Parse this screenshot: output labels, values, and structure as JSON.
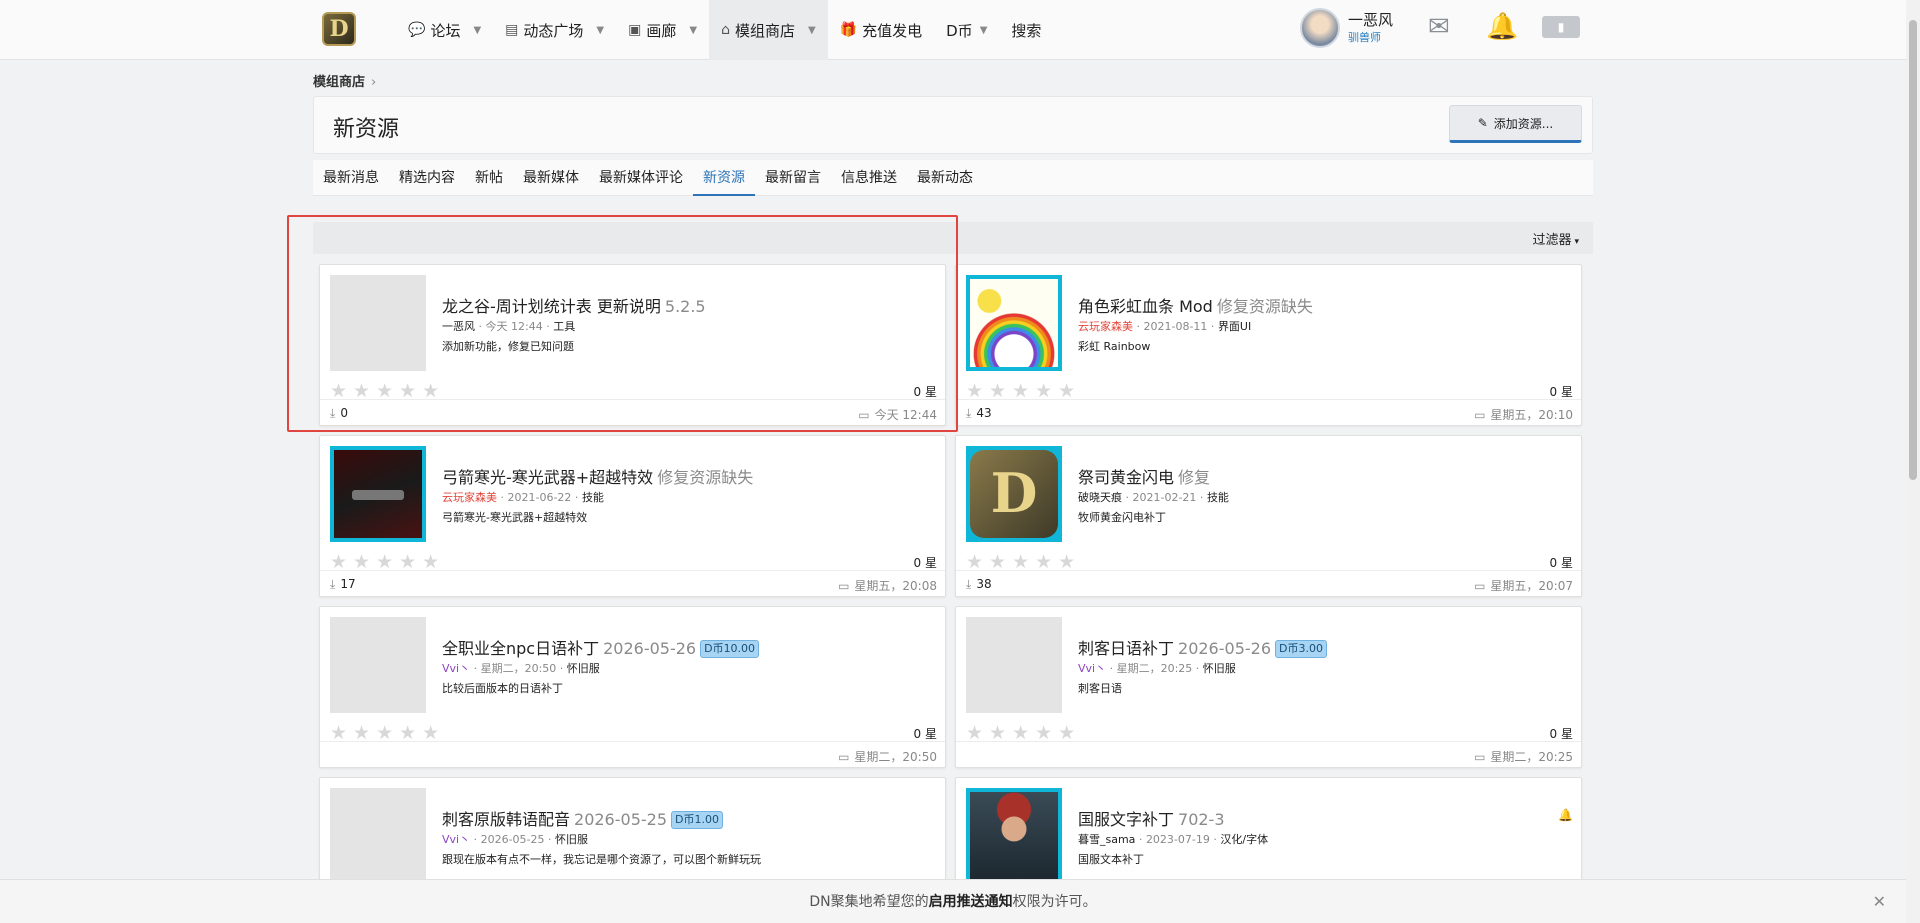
{
  "header": {
    "logo": "D",
    "nav": [
      {
        "label": "论坛",
        "icon": "chat-icon",
        "dropdown": true
      },
      {
        "label": "动态广场",
        "icon": "feed-icon",
        "dropdown": true
      },
      {
        "label": "画廊",
        "icon": "image-icon",
        "dropdown": true
      },
      {
        "label": "模组商店",
        "icon": "store-icon",
        "dropdown": true,
        "active": true
      },
      {
        "label": "充值发电",
        "icon": "gift-icon",
        "dropdown": false
      },
      {
        "label": "D币",
        "icon": "",
        "dropdown": true
      },
      {
        "label": "搜索",
        "icon": "",
        "dropdown": false
      }
    ],
    "user": {
      "name": "一恶风",
      "title": "驯兽师"
    }
  },
  "breadcrumb": {
    "item": "模组商店",
    "sep": "›"
  },
  "page": {
    "title": "新资源",
    "add_button": "添加资源..."
  },
  "tabs": [
    "最新消息",
    "精选内容",
    "新帖",
    "最新媒体",
    "最新媒体评论",
    "新资源",
    "最新留言",
    "信息推送",
    "最新动态"
  ],
  "active_tab": "新资源",
  "filter": {
    "label": "过滤器",
    "caret": "▾"
  },
  "resources": [
    {
      "title": "龙之谷-周计划统计表",
      "suffix": "更新说明",
      "version": "5.2.5",
      "badge": "",
      "author": "一恶风",
      "author_color": "default",
      "date": "今天 12:44",
      "category": "工具",
      "desc": "添加新功能，修复已知问题",
      "rating": "0 星",
      "downloads": "0",
      "updated": "今天 12:44",
      "thumb": "blank"
    },
    {
      "title": "角色彩虹血条 Mod",
      "suffix": "",
      "version": "修复资源缺失",
      "badge": "",
      "author": "云玩家森美",
      "author_color": "red",
      "date": "2021-08-11",
      "category": "界面UI",
      "desc": "彩虹 Rainbow",
      "rating": "0 星",
      "downloads": "43",
      "updated": "星期五，20:10",
      "thumb": "rainbow"
    },
    {
      "title": "弓箭寒光-寒光武器+超越特效",
      "suffix": "",
      "version": "修复资源缺失",
      "badge": "",
      "author": "云玩家森美",
      "author_color": "red",
      "date": "2021-06-22",
      "category": "技能",
      "desc": "弓箭寒光-寒光武器+超越特效",
      "rating": "0 星",
      "downloads": "17",
      "updated": "星期五，20:08",
      "thumb": "dark"
    },
    {
      "title": "祭司黄金闪电",
      "suffix": "",
      "version": "修复",
      "badge": "",
      "author": "破晓天痕",
      "author_color": "default",
      "date": "2021-02-21",
      "category": "技能",
      "desc": "牧师黄金闪电补丁",
      "rating": "0 星",
      "downloads": "38",
      "updated": "星期五，20:07",
      "thumb": "dn"
    },
    {
      "title": "全职业全npc日语补丁",
      "suffix": "",
      "version": "2026-05-26",
      "badge": "D币10.00",
      "author": "Vvi丶",
      "author_color": "purple",
      "date": "星期二，20:50",
      "category": "怀旧服",
      "desc": "比较后面版本的日语补丁",
      "rating": "0 星",
      "downloads": "",
      "updated": "星期二，20:50",
      "thumb": "blank"
    },
    {
      "title": "刺客日语补丁",
      "suffix": "",
      "version": "2026-05-26",
      "badge": "D币3.00",
      "author": "Vvi丶",
      "author_color": "purple",
      "date": "星期二，20:25",
      "category": "怀旧服",
      "desc": "刺客日语",
      "rating": "0 星",
      "downloads": "",
      "updated": "星期二，20:25",
      "thumb": "blank"
    },
    {
      "title": "刺客原版韩语配音",
      "suffix": "",
      "version": "2026-05-25",
      "badge": "D币1.00",
      "author": "Vvi丶",
      "author_color": "purple",
      "date": "2026-05-25",
      "category": "怀旧服",
      "desc": "跟现在版本有点不一样，我忘记是哪个资源了，可以图个新鲜玩玩",
      "rating": "",
      "downloads": "",
      "updated": "",
      "thumb": "blank"
    },
    {
      "title": "国服文字补丁",
      "suffix": "",
      "version": "702-3",
      "badge": "",
      "author": "暮雪_sama",
      "author_color": "default",
      "date": "2023-07-19",
      "category": "汉化/字体",
      "desc": "国服文本补丁",
      "rating": "",
      "downloads": "",
      "updated": "",
      "thumb": "pirate"
    }
  ],
  "notice": {
    "pre": "DN聚集地希望您的",
    "bold": "启用推送通知",
    "post": "权限为许可。",
    "close": "✕"
  },
  "colors": {
    "accent": "#2d74b8",
    "highlight": "#e0463f",
    "badge": "#a7d4f3"
  }
}
